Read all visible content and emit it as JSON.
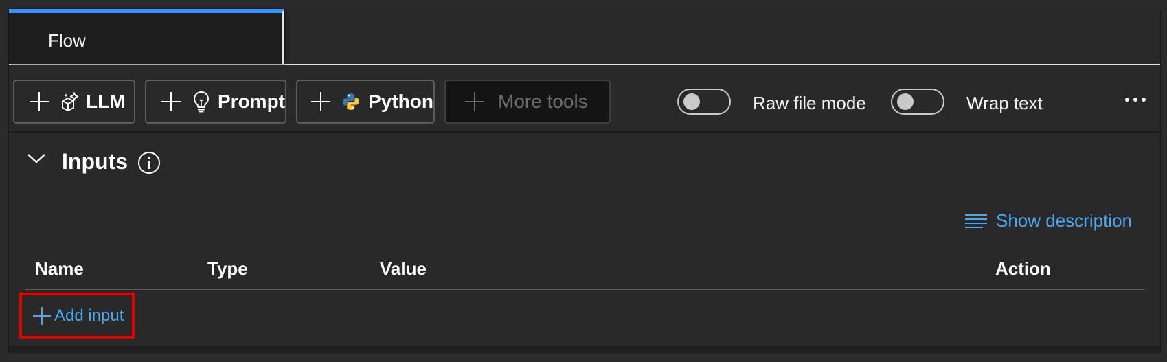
{
  "tabs": [
    {
      "label": "Flow",
      "active": true
    }
  ],
  "toolbar": {
    "buttons": [
      {
        "label": "LLM",
        "icon": "llm-cube-sparkle-icon",
        "enabled": true
      },
      {
        "label": "Prompt",
        "icon": "lightbulb-icon",
        "enabled": true
      },
      {
        "label": "Python",
        "icon": "python-icon",
        "enabled": true
      },
      {
        "label": "More tools",
        "icon": "plus-icon",
        "enabled": false
      }
    ],
    "toggles": [
      {
        "label": "Raw file mode",
        "on": false
      },
      {
        "label": "Wrap text",
        "on": false
      }
    ],
    "more_icon": "ellipsis-icon"
  },
  "inputs_section": {
    "title": "Inputs",
    "expanded": true,
    "show_description_label": "Show description",
    "columns": [
      "Name",
      "Type",
      "Value",
      "Action"
    ],
    "add_input_label": "Add input"
  },
  "colors": {
    "accent": "#3794ff",
    "link": "#4aa7f0",
    "highlight": "#e60000",
    "background": "#292929"
  }
}
